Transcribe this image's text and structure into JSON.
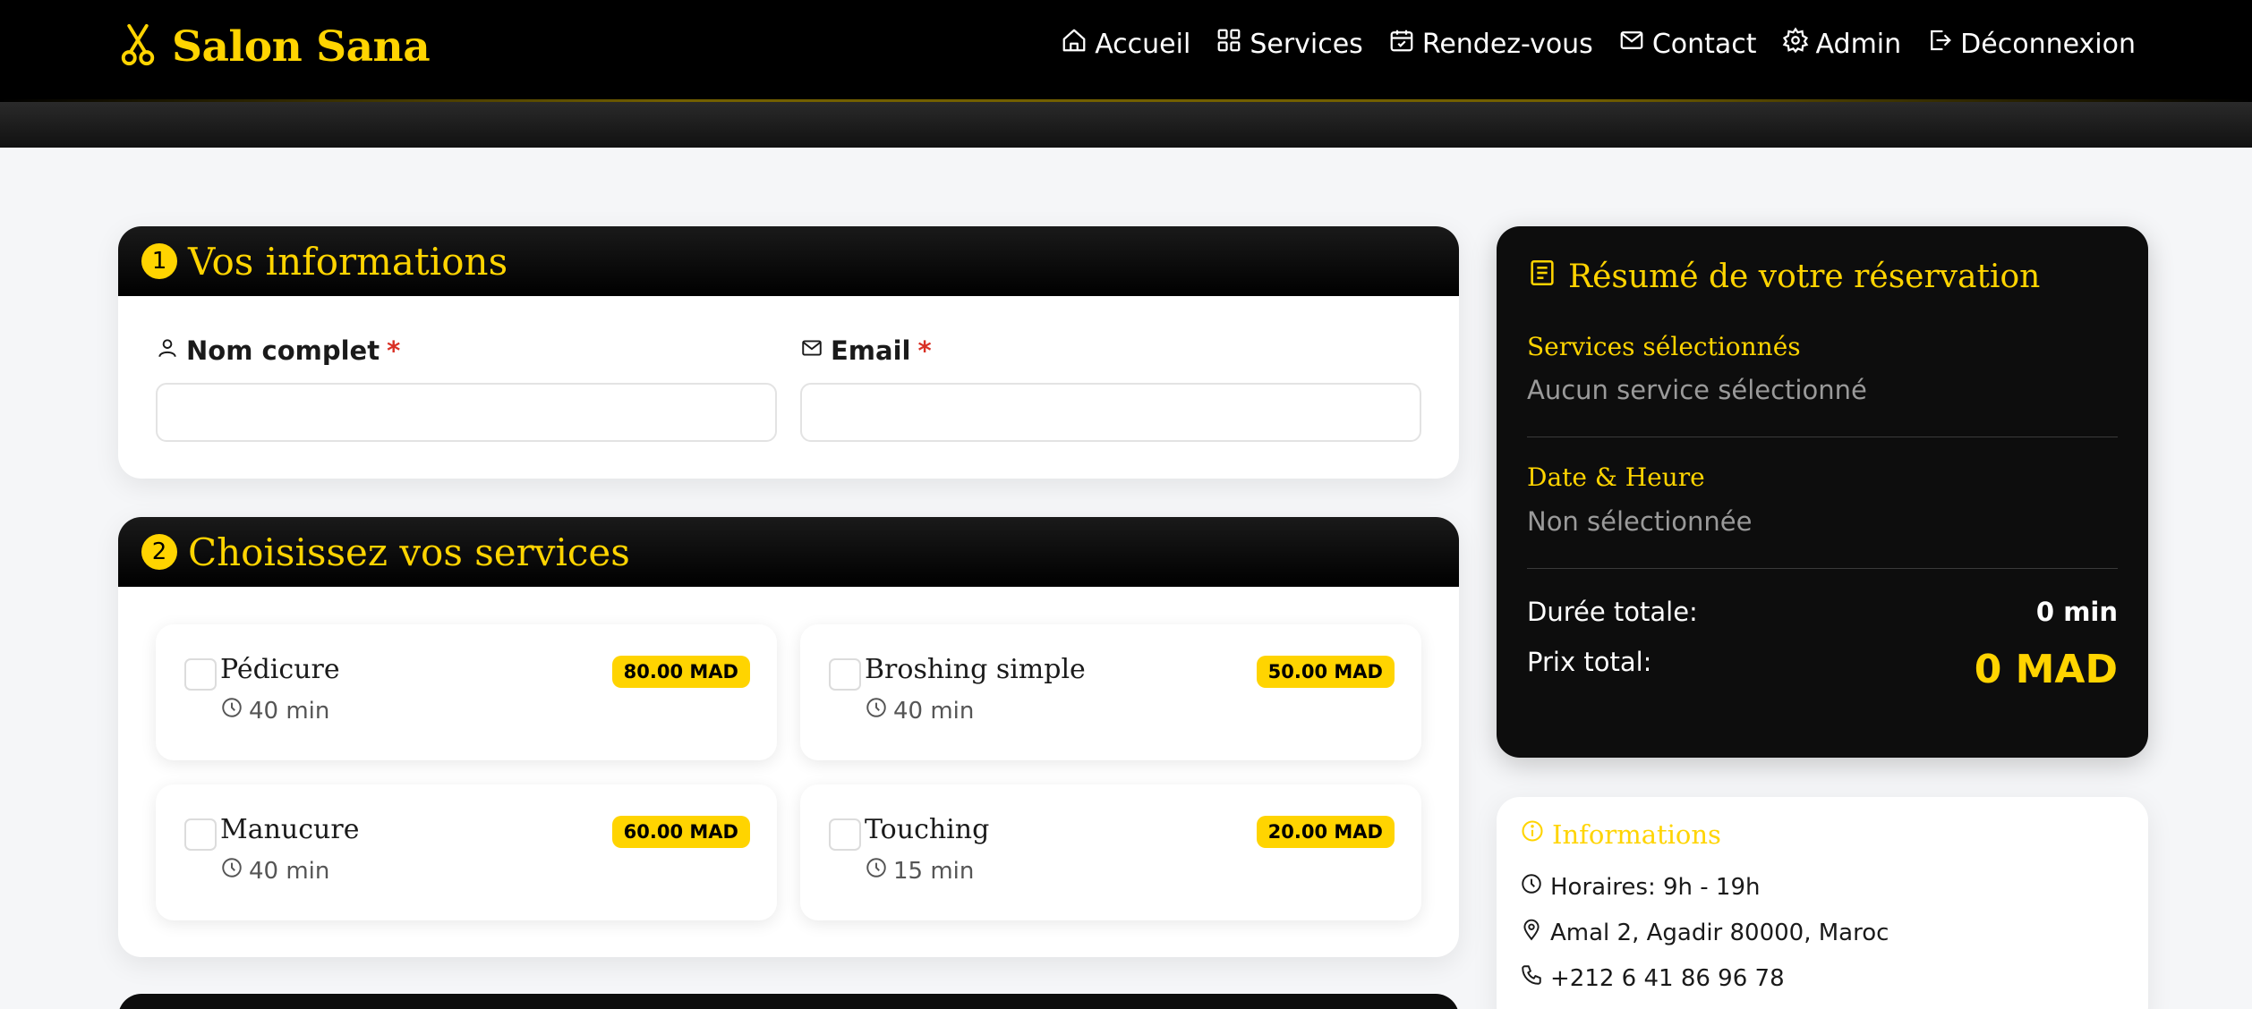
{
  "brand": {
    "name": "Salon Sana"
  },
  "nav": {
    "items": [
      {
        "label": "Accueil",
        "icon": "home-icon"
      },
      {
        "label": "Services",
        "icon": "grid-icon"
      },
      {
        "label": "Rendez-vous",
        "icon": "calendar-check-icon"
      },
      {
        "label": "Contact",
        "icon": "envelope-icon"
      },
      {
        "label": "Admin",
        "icon": "gear-icon"
      },
      {
        "label": "Déconnexion",
        "icon": "logout-icon"
      }
    ]
  },
  "step1": {
    "number": "1",
    "title": "Vos informations",
    "name_label": "Nom complet",
    "email_label": "Email",
    "required_mark": "*",
    "name_value": "",
    "email_value": ""
  },
  "step2": {
    "number": "2",
    "title": "Choisissez vos services",
    "services": [
      {
        "name": "Pédicure",
        "duration": "40 min",
        "price": "80.00 MAD",
        "checked": false
      },
      {
        "name": "Broshing simple",
        "duration": "40 min",
        "price": "50.00 MAD",
        "checked": false
      },
      {
        "name": "Manucure",
        "duration": "40 min",
        "price": "60.00 MAD",
        "checked": false
      },
      {
        "name": "Touching",
        "duration": "15 min",
        "price": "20.00 MAD",
        "checked": false
      }
    ]
  },
  "summary": {
    "title": "Résumé de votre réservation",
    "services_label": "Services sélectionnés",
    "services_value": "Aucun service sélectionné",
    "datetime_label": "Date & Heure",
    "datetime_value": "Non sélectionnée",
    "duration_label": "Durée totale:",
    "duration_value": "0 min",
    "price_label": "Prix total:",
    "price_value": "0 MAD"
  },
  "info": {
    "title": "Informations",
    "hours": "Horaires: 9h - 19h",
    "address": "Amal 2, Agadir 80000, Maroc",
    "phone": "+212 6 41 86 96 78"
  },
  "colors": {
    "accent": "#ffd400",
    "dark": "#000000",
    "required": "#d93025"
  }
}
